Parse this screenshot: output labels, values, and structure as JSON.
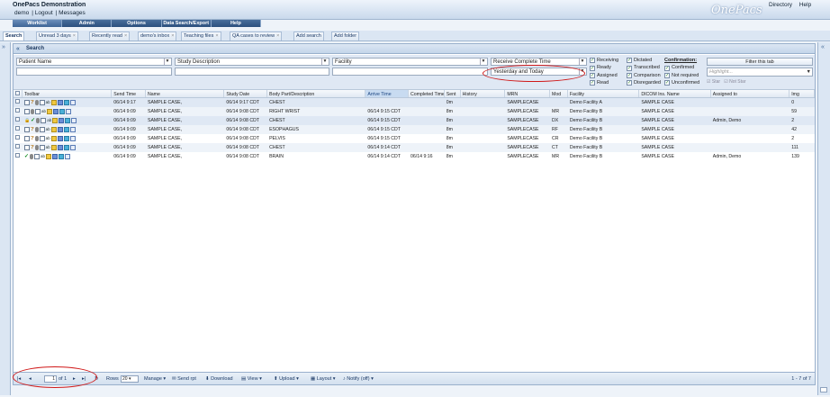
{
  "app": {
    "title": "OnePacs Demonstration",
    "user": "demo",
    "logout": "Logout",
    "messages": "Messages",
    "logo": "OnePacs",
    "directory": "Directory",
    "help": "Help"
  },
  "menu": [
    "Worklist",
    "Admin",
    "Options",
    "Data Search/Export",
    "Help"
  ],
  "tabs": [
    {
      "label": "Search",
      "closable": false
    },
    {
      "label": "Unread 3 days",
      "closable": true
    },
    {
      "label": "Recently read",
      "closable": true
    },
    {
      "label": "demo's inbox",
      "closable": true
    },
    {
      "label": "Teaching files",
      "closable": true
    },
    {
      "label": "QA cases to review",
      "closable": true
    },
    {
      "label": "Add search",
      "closable": false
    },
    {
      "label": "Add folder",
      "closable": false
    }
  ],
  "search": {
    "title": "Search",
    "patient_name": "Patient Name",
    "study_description": "Study Description",
    "facility": "Facility",
    "time_field": "Receive Complete Time",
    "time_range": "Yesterday and Today",
    "status_col1": [
      {
        "label": "Receiving",
        "checked": true
      },
      {
        "label": "Ready",
        "checked": true
      },
      {
        "label": "Assigned",
        "checked": true
      },
      {
        "label": "Read",
        "checked": true
      }
    ],
    "status_col2": [
      {
        "label": "Dictated",
        "checked": true
      },
      {
        "label": "Transcribed",
        "checked": true
      },
      {
        "label": "Comparison",
        "checked": true
      },
      {
        "label": "Disregarded",
        "checked": true
      }
    ],
    "confirmation_title": "Confirmation:",
    "confirmation": [
      {
        "label": "Confirmed",
        "checked": true
      },
      {
        "label": "Not required",
        "checked": true
      },
      {
        "label": "Unconfirmed",
        "checked": true
      }
    ],
    "filter_tab": "Filter this tab",
    "highlight_placeholder": "Highlight...",
    "star": "Star",
    "not_star": "Not Star"
  },
  "columns": [
    "Toolbar",
    "Send Time",
    "Name",
    "Study Date",
    "Body Part/Description",
    "Arrive Time",
    "Completed Time",
    "Sent",
    "History",
    "MRN",
    "Mod",
    "Facility",
    "DICOM Ins. Name",
    "Assigned to",
    "Img"
  ],
  "rows": [
    {
      "send": "06/14 9:17",
      "name": "SAMPLE CASE,",
      "study": "06/14 9:17 CDT",
      "body": "CHEST",
      "arrive": "",
      "completed": "",
      "sent": "0m",
      "history": "",
      "mrn": "SAMPLECASE",
      "mod": "",
      "facility": "Demo Facility A",
      "dicom": "SAMPLE CASE",
      "assigned": "",
      "img": "0",
      "icons": "q"
    },
    {
      "send": "06/14 9:09",
      "name": "SAMPLE CASE,",
      "study": "06/14 9:08 CDT",
      "body": "RIGHT WRIST",
      "arrive": "06/14 9:15 CDT",
      "completed": "",
      "sent": "8m",
      "history": "",
      "mrn": "SAMPLECASE",
      "mod": "MR",
      "facility": "Demo Facility B",
      "dicom": "SAMPLE CASE",
      "assigned": "",
      "img": "59",
      "icons": "b"
    },
    {
      "send": "06/14 9:09",
      "name": "SAMPLE CASE,",
      "study": "06/14 9:08 CDT",
      "body": "CHEST",
      "arrive": "06/14 9:15 CDT",
      "completed": "",
      "sent": "8m",
      "history": "",
      "mrn": "SAMPLECASE",
      "mod": "DX",
      "facility": "Demo Facility B",
      "dicom": "SAMPLE CASE",
      "assigned": "Admin, Demo",
      "img": "2",
      "icons": "lc"
    },
    {
      "send": "06/14 9:09",
      "name": "SAMPLE CASE,",
      "study": "06/14 9:08 CDT",
      "body": "ESOPHAGUS",
      "arrive": "06/14 9:15 CDT",
      "completed": "",
      "sent": "8m",
      "history": "",
      "mrn": "SAMPLECASE",
      "mod": "RF",
      "facility": "Demo Facility B",
      "dicom": "SAMPLE CASE",
      "assigned": "",
      "img": "42",
      "icons": "bq"
    },
    {
      "send": "06/14 9:09",
      "name": "SAMPLE CASE,",
      "study": "06/14 9:08 CDT",
      "body": "PELVIS",
      "arrive": "06/14 9:15 CDT",
      "completed": "",
      "sent": "8m",
      "history": "",
      "mrn": "SAMPLECASE",
      "mod": "CR",
      "facility": "Demo Facility B",
      "dicom": "SAMPLE CASE",
      "assigned": "",
      "img": "2",
      "icons": "bq"
    },
    {
      "send": "06/14 9:09",
      "name": "SAMPLE CASE,",
      "study": "06/14 9:08 CDT",
      "body": "CHEST",
      "arrive": "06/14 9:14 CDT",
      "completed": "",
      "sent": "8m",
      "history": "",
      "mrn": "SAMPLECASE",
      "mod": "CT",
      "facility": "Demo Facility B",
      "dicom": "SAMPLE CASE",
      "assigned": "",
      "img": "111",
      "icons": "bq"
    },
    {
      "send": "06/14 9:09",
      "name": "SAMPLE CASE,",
      "study": "06/14 9:08 CDT",
      "body": "BRAIN",
      "arrive": "06/14 9:14 CDT",
      "completed": "06/14 9:16",
      "sent": "8m",
      "history": "",
      "mrn": "SAMPLECASE",
      "mod": "MR",
      "facility": "Demo Facility B",
      "dicom": "SAMPLE CASE",
      "assigned": "Admin, Demo",
      "img": "139",
      "icons": "c"
    }
  ],
  "pager": {
    "page": "1",
    "of": "of 1",
    "rows_label": "Rows",
    "rows": "20",
    "manage": "Manage",
    "send_rpt": "Send rpt",
    "download": "Download",
    "view": "View",
    "upload": "Upload",
    "layout": "Layout",
    "notify": "Notify (off)",
    "count": "1 - 7 of 7"
  }
}
